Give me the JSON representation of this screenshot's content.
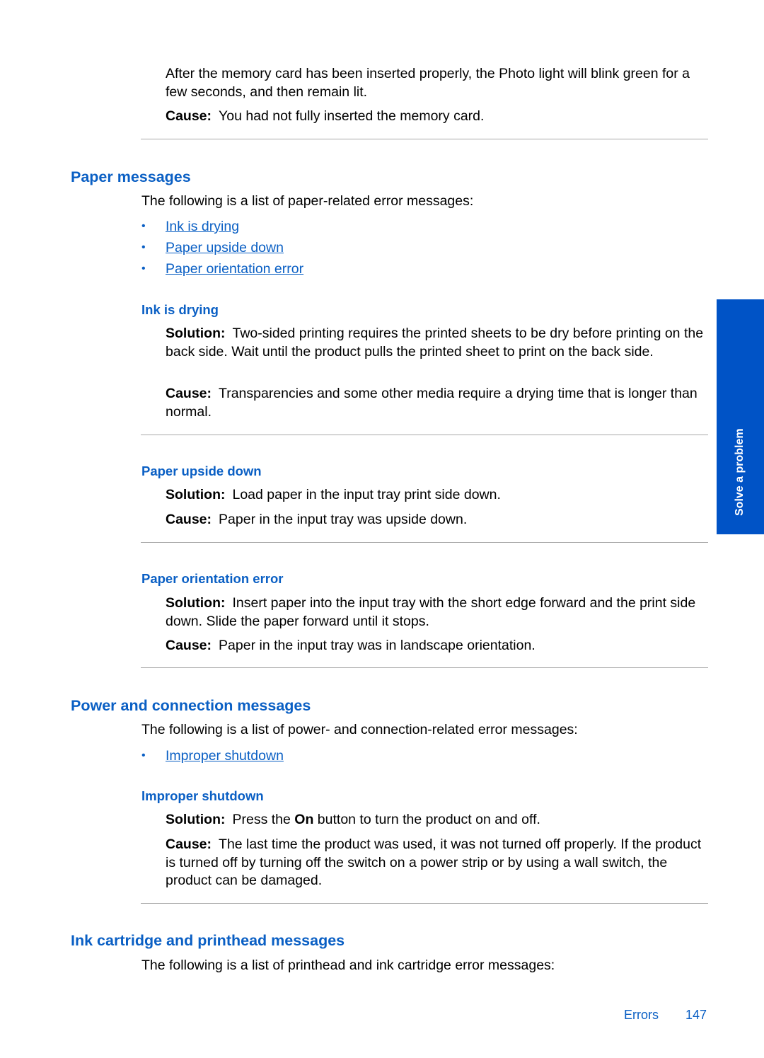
{
  "top_section": {
    "body": "After the memory card has been inserted properly, the Photo light will blink green for a few seconds, and then remain lit.",
    "cause_label": "Cause:",
    "cause_text": "You had not fully inserted the memory card."
  },
  "paper_messages": {
    "heading": "Paper messages",
    "intro": "The following is a list of paper-related error messages:",
    "links": [
      {
        "bullet": "•",
        "label": "Ink is drying"
      },
      {
        "bullet": "•",
        "label": "Paper upside down"
      },
      {
        "bullet": "•",
        "label": "Paper orientation error"
      }
    ],
    "ink_is_drying": {
      "heading": "Ink is drying",
      "solution_label": "Solution:",
      "solution_text": "Two-sided printing requires the printed sheets to be dry before printing on the back side. Wait until the product pulls the printed sheet to print on the back side.",
      "cause_label": "Cause:",
      "cause_text": "Transparencies and some other media require a drying time that is longer than normal."
    },
    "paper_upside_down": {
      "heading": "Paper upside down",
      "solution_label": "Solution:",
      "solution_text": "Load paper in the input tray print side down.",
      "cause_label": "Cause:",
      "cause_text": "Paper in the input tray was upside down."
    },
    "paper_orientation_error": {
      "heading": "Paper orientation error",
      "solution_label": "Solution:",
      "solution_text": "Insert paper into the input tray with the short edge forward and the print side down. Slide the paper forward until it stops.",
      "cause_label": "Cause:",
      "cause_text": "Paper in the input tray was in landscape orientation."
    }
  },
  "power_messages": {
    "heading": "Power and connection messages",
    "intro": "The following is a list of power- and connection-related error messages:",
    "links": [
      {
        "bullet": "•",
        "label": "Improper shutdown"
      }
    ],
    "improper_shutdown": {
      "heading": "Improper shutdown",
      "solution_label": "Solution:",
      "solution_pre": "Press the ",
      "solution_bold": "On",
      "solution_post": " button to turn the product on and off.",
      "cause_label": "Cause:",
      "cause_text": "The last time the product was used, it was not turned off properly. If the product is turned off by turning off the switch on a power strip or by using a wall switch, the product can be damaged."
    }
  },
  "ink_messages": {
    "heading": "Ink cartridge and printhead messages",
    "intro": "The following is a list of printhead and ink cartridge error messages:"
  },
  "side_tab": {
    "label": "Solve a problem",
    "color": "#0053c6"
  },
  "footer": {
    "section": "Errors",
    "page_number": "147"
  },
  "colors": {
    "heading_blue": "#0a5fc4",
    "divider_gray": "#a8a8a8"
  }
}
